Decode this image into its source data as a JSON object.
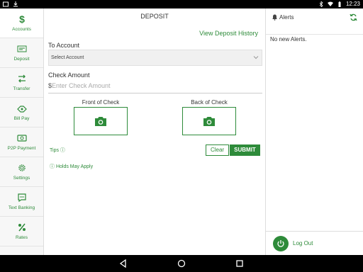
{
  "status": {
    "time": "12:23"
  },
  "sidebar": {
    "items": [
      {
        "label": "Accounts",
        "icon": "dollar-icon"
      },
      {
        "label": "Deposit",
        "icon": "check-deposit-icon"
      },
      {
        "label": "Transfer",
        "icon": "transfer-icon"
      },
      {
        "label": "Bill Pay",
        "icon": "bill-pay-icon"
      },
      {
        "label": "P2P Payment",
        "icon": "p2p-icon"
      },
      {
        "label": "Settings",
        "icon": "gear-icon"
      },
      {
        "label": "Text Banking",
        "icon": "chat-icon"
      },
      {
        "label": "Rates",
        "icon": "percent-icon"
      }
    ]
  },
  "main": {
    "title": "DEPOSIT",
    "history_link": "View Deposit History",
    "to_account_label": "To Account",
    "to_account_value": "Select Account",
    "amount_label": "Check Amount",
    "amount_currency": "$",
    "amount_placeholder": "Enter Check Amount",
    "front_label": "Front of Check",
    "back_label": "Back of Check",
    "tips_label": "Tips",
    "clear_label": "Clear",
    "submit_label": "SUBMIT",
    "holds_label": "Holds May Apply"
  },
  "alerts": {
    "title": "Alerts",
    "empty_text": "No new Alerts.",
    "logout_label": "Log Out"
  },
  "colors": {
    "accent": "#2e8b3a"
  }
}
